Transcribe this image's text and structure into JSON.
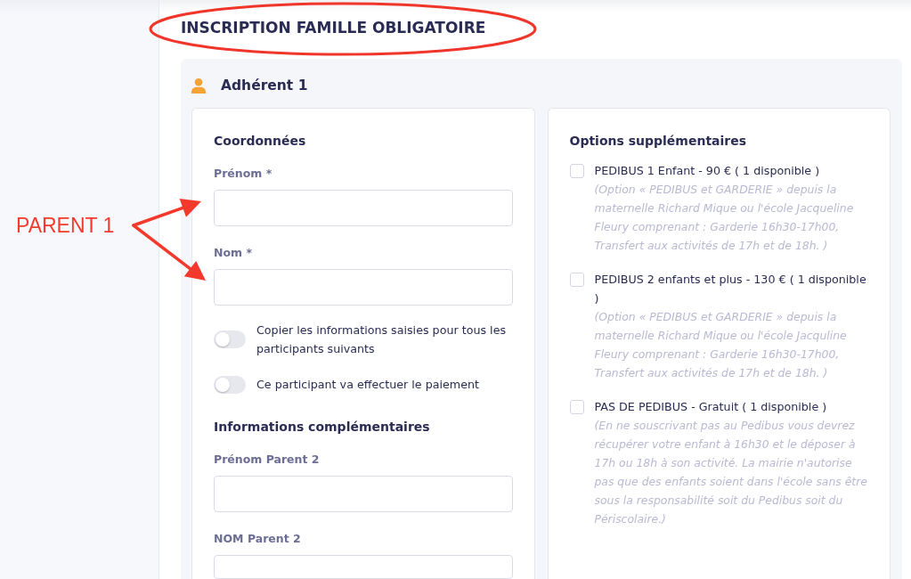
{
  "page_title": "INSCRIPTION FAMILLE OBLIGATOIRE",
  "annotation": {
    "label": "PARENT 1",
    "title_circled": true
  },
  "member": {
    "title": "Adhérent 1",
    "contact": {
      "heading": "Coordonnées",
      "fields": [
        {
          "label": "Prénom *"
        },
        {
          "label": "Nom *"
        }
      ],
      "toggles": [
        {
          "label": "Copier les informations saisies pour tous les participants suivants",
          "on": false
        },
        {
          "label": "Ce participant va effectuer le paiement",
          "on": false
        }
      ]
    },
    "additional": {
      "heading": "Informations complémentaires",
      "fields": [
        {
          "label": "Prénom Parent 2"
        },
        {
          "label": "NOM Parent 2"
        }
      ]
    },
    "options": {
      "heading": "Options supplémentaires",
      "items": [
        {
          "label": "PEDIBUS 1 Enfant - 90 € ( 1 disponible )",
          "description": "(Option « PEDIBUS et GARDERIE » depuis la maternelle Richard Mique ou l'école Jacqueline Fleury comprenant : Garderie 16h30-17h00, Transfert aux activités de 17h et de 18h. )",
          "checked": false
        },
        {
          "label": "PEDIBUS 2 enfants et plus - 130 € ( 1 disponible )",
          "description": "(Option « PEDIBUS et GARDERIE » depuis la maternelle Richard Mique ou l'école Jacquline Fleury comprenant : Garderie 16h30-17h00, Transfert aux activités de 17h et de 18h. )",
          "checked": false
        },
        {
          "label": "PAS DE PEDIBUS - Gratuit ( 1 disponible )",
          "description": "(En ne souscrivant pas au Pedibus vous devrez récupérer votre enfant à 16h30 et le déposer à 17h ou 18h à son activité. La mairie n'autorise pas que des enfants soient dans l'école sans être sous la responsabilité soit du Pedibus soit du Périscolaire.)",
          "checked": false
        }
      ]
    }
  }
}
